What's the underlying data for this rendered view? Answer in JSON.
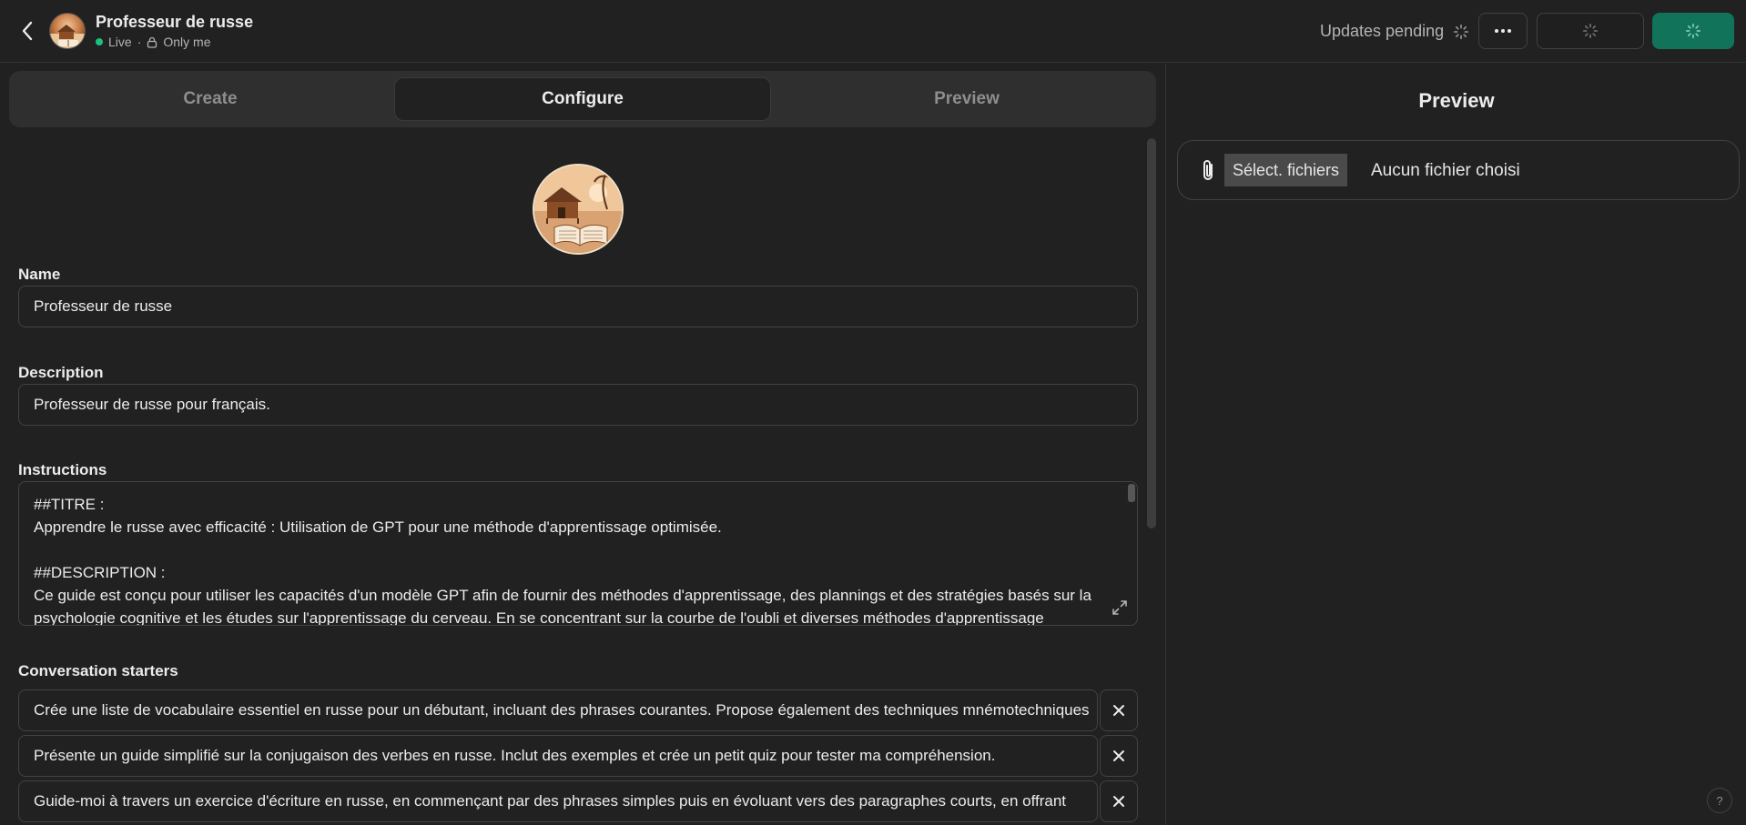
{
  "header": {
    "title": "Professeur de russe",
    "status": "Live",
    "visibility": "Only me",
    "updates_pending": "Updates pending",
    "live_color": "#19c37d",
    "update_button_color": "#10735a"
  },
  "tabs": [
    {
      "label": "Create",
      "active": false
    },
    {
      "label": "Configure",
      "active": true
    },
    {
      "label": "Preview",
      "active": false
    }
  ],
  "form": {
    "name_label": "Name",
    "name_value": "Professeur de russe",
    "description_label": "Description",
    "description_value": "Professeur de russe pour français.",
    "instructions_label": "Instructions",
    "instructions_lines": [
      "##TITRE :",
      "Apprendre le russe avec efficacité : Utilisation de GPT pour une méthode d'apprentissage optimisée.",
      "",
      "##DESCRIPTION :",
      "Ce guide est conçu pour utiliser les capacités d'un modèle GPT afin de fournir des méthodes d'apprentissage, des plannings et des stratégies basés sur la",
      "psychologie cognitive et les études sur l'apprentissage du cerveau. En se concentrant sur la courbe de l'oubli et diverses méthodes d'apprentissage"
    ],
    "starters_label": "Conversation starters",
    "starters": [
      "Crée une liste de vocabulaire essentiel en russe pour un débutant, incluant des phrases courantes. Propose également des techniques mnémotechniques",
      "Présente un guide simplifié sur la conjugaison des verbes en russe. Inclut des exemples et crée un petit quiz pour tester ma compréhension.",
      "Guide-moi à travers un exercice d'écriture en russe, en commençant par des phrases simples puis en évoluant vers des paragraphes courts, en offrant"
    ]
  },
  "preview": {
    "title": "Preview",
    "file_button": "Sélect. fichiers",
    "file_status": "Aucun fichier choisi"
  },
  "help": "?"
}
